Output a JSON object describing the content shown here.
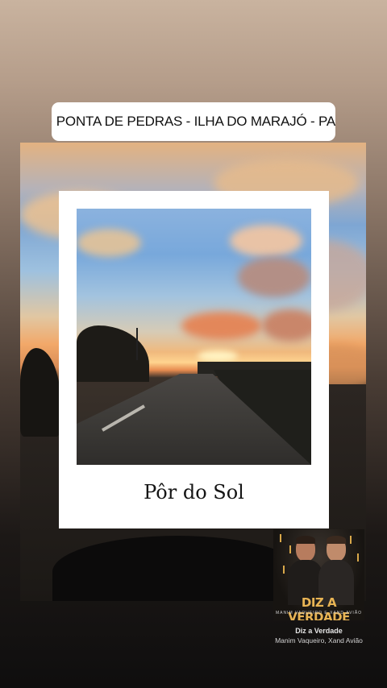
{
  "location_sticker": {
    "text": "PONTA DE PEDRAS - ILHA DO MARAJÓ - PA",
    "icon": "map-pin-icon",
    "pin_color": "#e8457a"
  },
  "polaroid": {
    "caption": "Pôr do Sol"
  },
  "music_sticker": {
    "album_art_title": "DIZ A VERDADE",
    "album_art_subtitle": "MANIM VAQUEIRO E XAND AVIÃO",
    "song_title": "Diz a Verdade",
    "artists": "Manim Vaqueiro, Xand Avião",
    "accent_color": "#e8b454"
  }
}
